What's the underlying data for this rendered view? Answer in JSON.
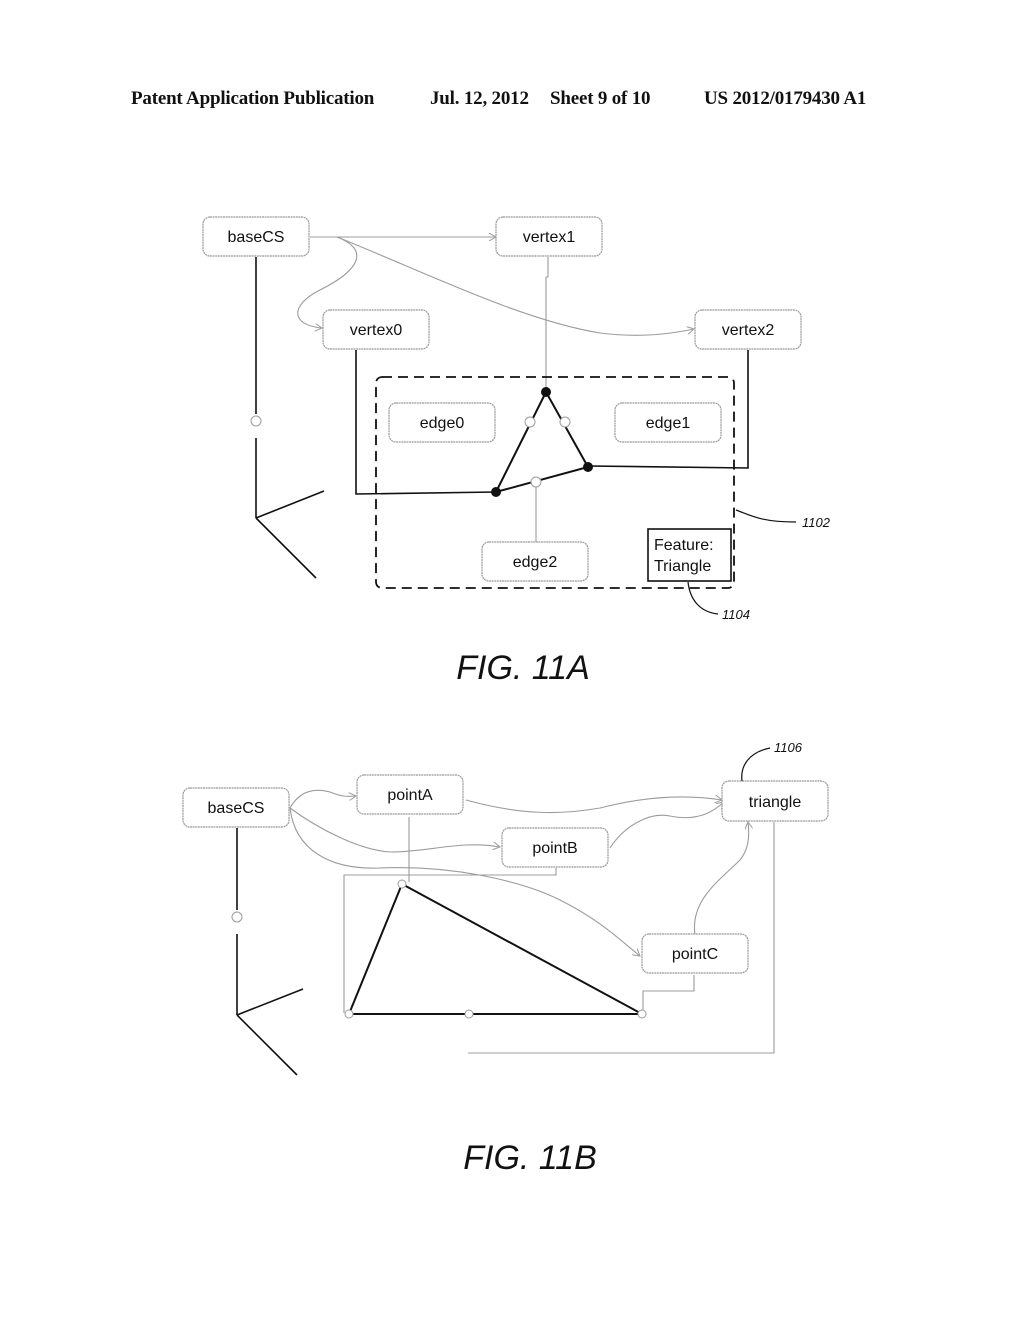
{
  "header": {
    "publication": "Patent Application Publication",
    "date": "Jul. 12, 2012",
    "sheet": "Sheet 9 of 10",
    "patent_number": "US 2012/0179430 A1"
  },
  "fig11a": {
    "caption": "FIG. 11A",
    "nodes": {
      "baseCS": "baseCS",
      "vertex0": "vertex0",
      "vertex1": "vertex1",
      "vertex2": "vertex2",
      "edge0": "edge0",
      "edge1": "edge1",
      "edge2": "edge2"
    },
    "feature_label_line1": "Feature:",
    "feature_label_line2": "Triangle",
    "refs": {
      "group": "1102",
      "feature": "1104"
    }
  },
  "fig11b": {
    "caption": "FIG. 11B",
    "nodes": {
      "baseCS": "baseCS",
      "pointA": "pointA",
      "pointB": "pointB",
      "pointC": "pointC",
      "triangle": "triangle"
    },
    "refs": {
      "triangle": "1106"
    }
  }
}
